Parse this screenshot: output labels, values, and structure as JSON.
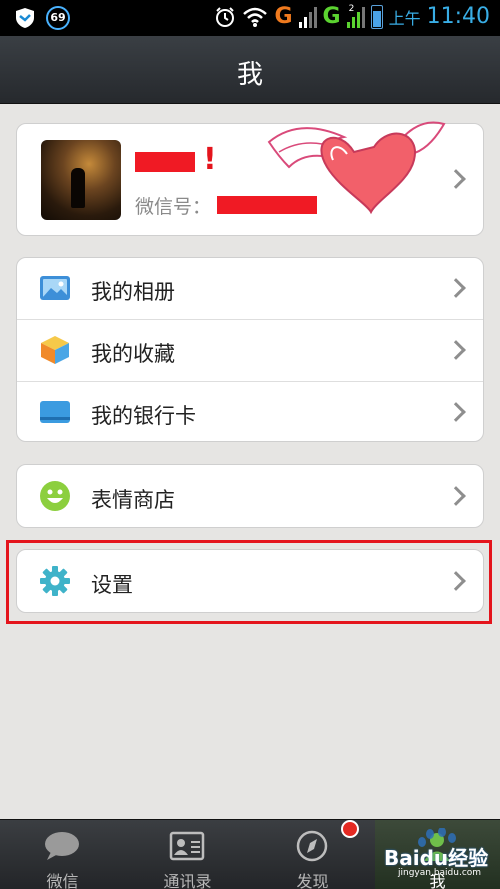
{
  "status_bar": {
    "notification_count": "69",
    "network_1": "G",
    "network_2": "G",
    "sim_2_index": "2",
    "ampm": "上午",
    "time": "11:40"
  },
  "title_bar": {
    "title": "我"
  },
  "profile": {
    "wechat_id_label": "微信号："
  },
  "menu": {
    "items": [
      {
        "label": "我的相册",
        "icon": "photo-album-icon"
      },
      {
        "label": "我的收藏",
        "icon": "favorites-box-icon"
      },
      {
        "label": "我的银行卡",
        "icon": "bank-card-icon"
      }
    ],
    "sticker_store": {
      "label": "表情商店",
      "icon": "smiley-icon"
    },
    "settings": {
      "label": "设置",
      "icon": "gear-icon"
    }
  },
  "tabs": [
    {
      "label": "微信",
      "icon": "chat-bubble-icon"
    },
    {
      "label": "通讯录",
      "icon": "contacts-card-icon"
    },
    {
      "label": "发现",
      "icon": "compass-icon"
    },
    {
      "label": "我",
      "icon": "person-icon"
    }
  ],
  "watermark": {
    "brand": "Baidu经验",
    "url": "jingyan.baidu.com"
  },
  "colors": {
    "highlight": "#e4141c",
    "accent_blue": "#39aee6",
    "notification_dot": "#e42a22"
  }
}
